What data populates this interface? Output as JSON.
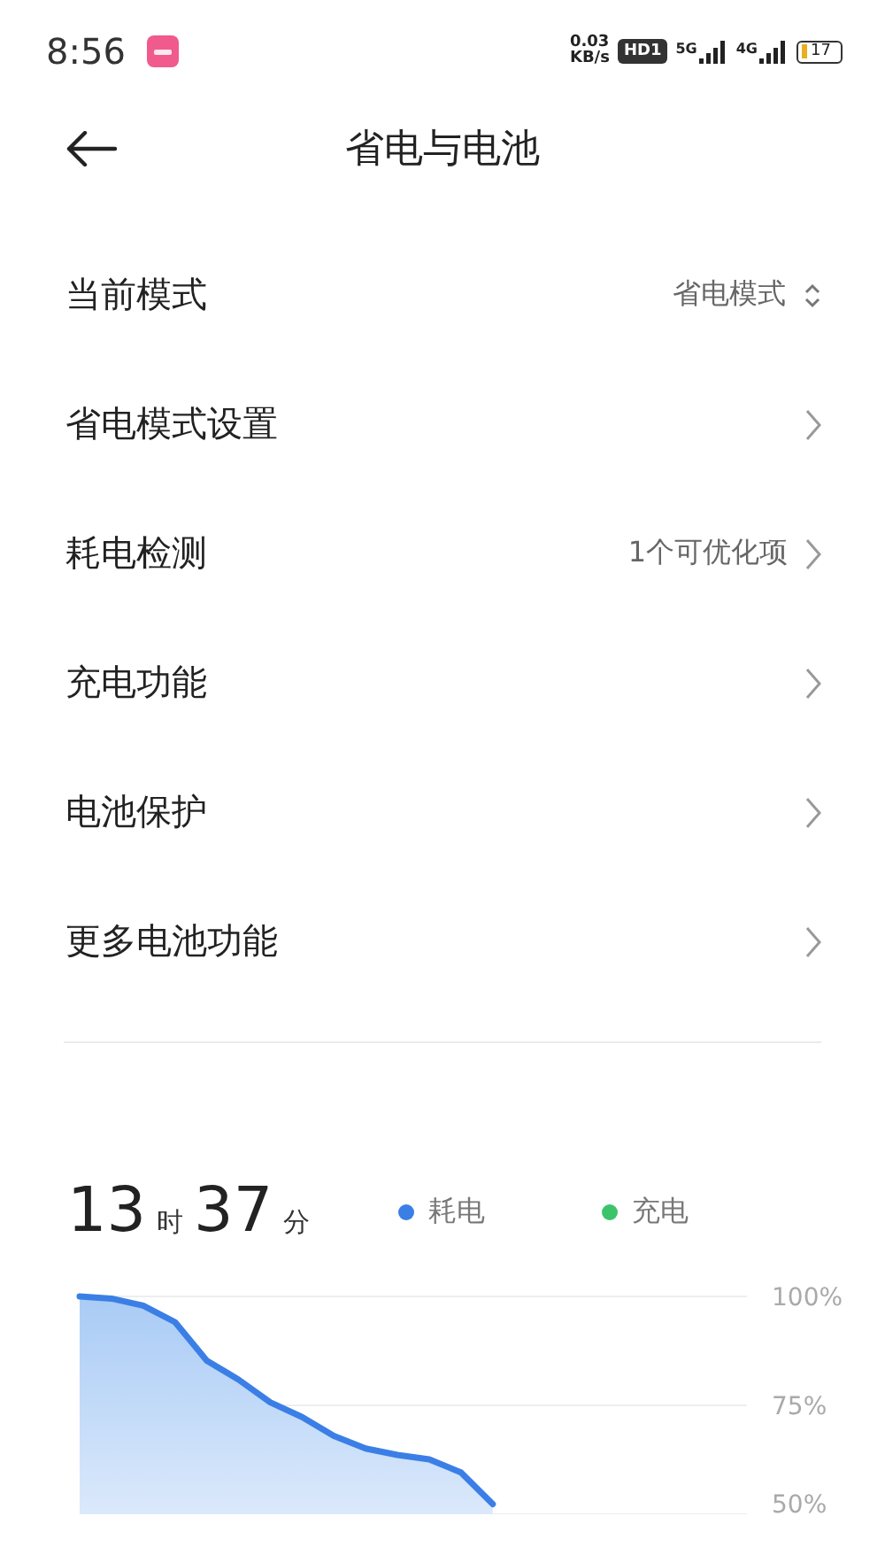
{
  "status_bar": {
    "time": "8:56",
    "net_speed": "0.03",
    "net_unit": "KB/s",
    "hd": "HD1",
    "sim1": "5G",
    "sim2": "4G",
    "battery": "17"
  },
  "header": {
    "title": "省电与电池"
  },
  "rows": [
    {
      "label": "当前模式",
      "value": "省电模式",
      "kind": "selector"
    },
    {
      "label": "省电模式设置",
      "kind": "link"
    },
    {
      "label": "耗电检测",
      "value": "1个可优化项",
      "kind": "link"
    },
    {
      "label": "充电功能",
      "kind": "link"
    },
    {
      "label": "电池保护",
      "kind": "link"
    },
    {
      "label": "更多电池功能",
      "kind": "link"
    }
  ],
  "usage": {
    "hours": "13",
    "hours_unit": "时",
    "minutes": "37",
    "minutes_unit": "分",
    "chart_data": {
      "type": "area",
      "ylim": [
        50,
        100
      ],
      "yticks": [
        {
          "value": 100,
          "label": "100%"
        },
        {
          "value": 75,
          "label": "75%"
        },
        {
          "value": 50,
          "label": "50%"
        }
      ],
      "categories": [
        null,
        null,
        null,
        null,
        null,
        null,
        null,
        null,
        null,
        null,
        null,
        null,
        null,
        null,
        null,
        null,
        null,
        null,
        null,
        null,
        null,
        null
      ],
      "series": [
        {
          "name": "耗电",
          "color": "#3b7fe6",
          "values": [
            100,
            99.5,
            97.9,
            94.1,
            85.3,
            80.9,
            75.7,
            72.3,
            68.0,
            65.1,
            63.6,
            62.6,
            59.6,
            52.3,
            null,
            null,
            null,
            null,
            null,
            null,
            null,
            null
          ]
        },
        {
          "name": "充电",
          "color": "#3cc46a",
          "values": [
            null,
            null,
            null,
            null,
            null,
            null,
            null,
            null,
            null,
            null,
            null,
            null,
            null,
            null,
            null,
            null,
            null,
            null,
            null,
            null,
            null,
            null
          ]
        }
      ]
    }
  }
}
